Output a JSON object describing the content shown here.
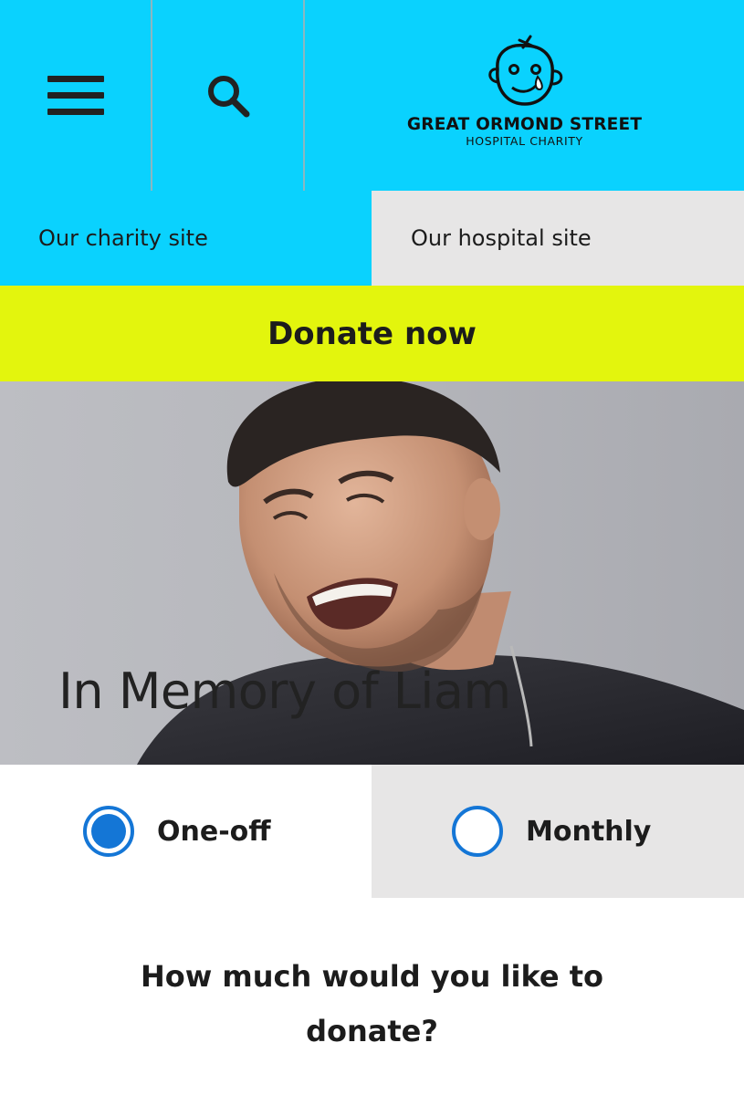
{
  "header": {
    "menu_icon": "hamburger-menu-icon",
    "search_icon": "search-icon",
    "logo": {
      "line1": "GREAT ORMOND STREET",
      "line2": "HOSPITAL CHARITY"
    }
  },
  "site_tabs": {
    "charity": "Our charity site",
    "hospital": "Our hospital site"
  },
  "donate_bar": {
    "label": "Donate now"
  },
  "hero": {
    "title": "In Memory of Liam"
  },
  "frequency": {
    "one_off": "One-off",
    "monthly": "Monthly",
    "selected": "One-off"
  },
  "question": {
    "line1": "How much would you like to",
    "line2": "donate?"
  },
  "colors": {
    "header": "#0ad2fe",
    "donate": "#e3f50d",
    "tab_inactive": "#e7e6e6",
    "radio": "#1476d6"
  }
}
